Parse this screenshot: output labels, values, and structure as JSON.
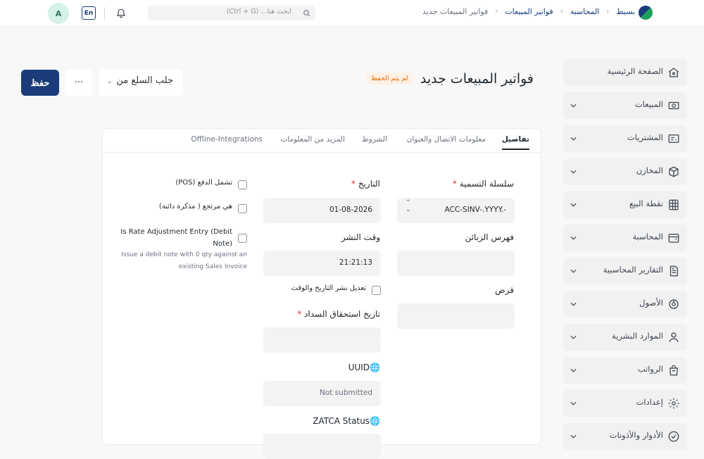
{
  "topbar": {
    "avatar": "A",
    "lang": "En",
    "search_placeholder": "ابحث هنا... (Ctrl + G)",
    "breadcrumbs": [
      "بسيط",
      "المحاسبة",
      "فواتير المبيعات",
      "فواتير المبيعات جديد"
    ]
  },
  "sidebar": {
    "items": [
      {
        "label": "الصفحة الرئيسية",
        "icon": "home-icon",
        "has_chevron": false
      },
      {
        "label": "المبيعات",
        "icon": "money-icon",
        "has_chevron": true
      },
      {
        "label": "المشتريات",
        "icon": "receipt-icon",
        "has_chevron": true
      },
      {
        "label": "المخازن",
        "icon": "box-icon",
        "has_chevron": true
      },
      {
        "label": "نقطة البيع",
        "icon": "pos-grid-icon",
        "has_chevron": true
      },
      {
        "label": "المحاسبة",
        "icon": "wallet-icon",
        "has_chevron": true
      },
      {
        "label": "التقارير المحاسبية",
        "icon": "report-icon",
        "has_chevron": true
      },
      {
        "label": "الأصول",
        "icon": "asset-icon",
        "has_chevron": true
      },
      {
        "label": "الموارد البشرية",
        "icon": "user-icon",
        "has_chevron": true
      },
      {
        "label": "الرواتب",
        "icon": "bag-icon",
        "has_chevron": true
      },
      {
        "label": "إعدادات",
        "icon": "gear-icon",
        "has_chevron": true
      },
      {
        "label": "الأدوار والأذونات",
        "icon": "shield-check-icon",
        "has_chevron": true
      }
    ]
  },
  "header": {
    "title": "فواتير المبيعات جديد",
    "status_badge": "لم يتم الحفظ",
    "save_label": "حفظ",
    "more_label": "···",
    "get_items_label": "جلب السلع من"
  },
  "tabs": [
    "تفاصيل",
    "معلومات الاتصال والعنوان",
    "الشروط",
    "المزيد من المعلومات",
    "Offline-Integrations"
  ],
  "form": {
    "naming_series_label": "سلسلة التسمية",
    "naming_series_value": "ACC-SINV-.YYYY.-",
    "customer_label": "فهرس الزبائن",
    "loan_label": "قرض",
    "date_label": "التاريخ",
    "date_value": "01-08-2026",
    "posting_time_label": "وقت النشر",
    "posting_time_value": "21:21:13",
    "edit_posting_label": "تعديل نشر التاريخ والوقت",
    "due_date_label": "تاريخ استحقاق السداد",
    "uuid_label": "UUID",
    "uuid_value": "Not submitted",
    "zatca_label": "ZATCA Status",
    "pos_label": "تشمل الدفع (POS)",
    "return_label": "هي مرتجع ( مذكرة دائنة)",
    "rate_adj_label_1": "Is Rate Adjustment Entry (Debit",
    "rate_adj_label_2": "Note)",
    "rate_adj_desc_1": "Issue a debit note with 0 qty against an",
    "rate_adj_desc_2": "existing Sales Invoice"
  }
}
